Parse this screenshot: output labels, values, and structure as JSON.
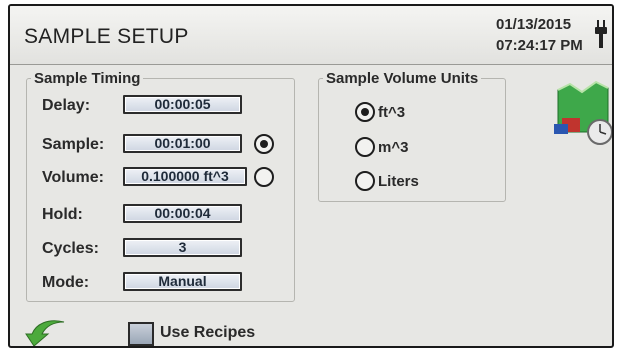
{
  "header": {
    "title": "SAMPLE SETUP",
    "date": "01/13/2015",
    "time": "07:24:17 PM"
  },
  "timing": {
    "legend": "Sample Timing",
    "rows": [
      {
        "label": "Delay:",
        "value": "00:00:05"
      },
      {
        "label": "Sample:",
        "value": "00:01:00"
      },
      {
        "label": "Volume:",
        "value": "0.100000 ft^3"
      },
      {
        "label": "Hold:",
        "value": "00:00:04"
      },
      {
        "label": "Cycles:",
        "value": "3"
      },
      {
        "label": "Mode:",
        "value": "Manual"
      }
    ],
    "selected_mode": "Sample"
  },
  "units": {
    "legend": "Sample Volume Units",
    "options": [
      "ft^3",
      "m^3",
      "Liters"
    ],
    "selected": "ft^3"
  },
  "footer": {
    "use_recipes_label": "Use Recipes",
    "use_recipes_checked": false
  },
  "icons": {
    "power": "power-plug-icon",
    "chart": "chart-clock-icon",
    "back": "back-arrow-icon"
  }
}
